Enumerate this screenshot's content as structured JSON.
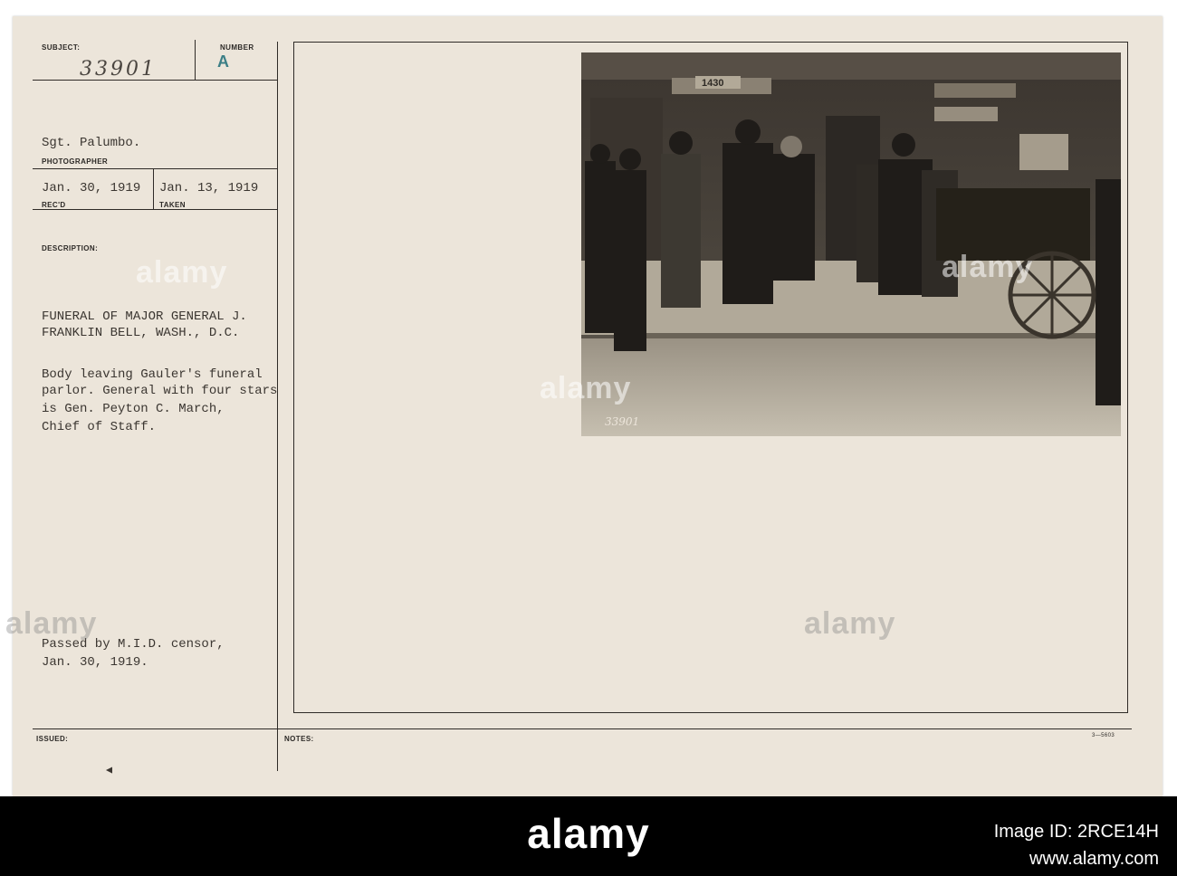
{
  "card": {
    "subject_label": "SUBJECT:",
    "number_label": "NUMBER",
    "subject_value": "33901",
    "number_value": "A",
    "photographer_name": "Sgt. Palumbo.",
    "photographer_label": "PHOTOGRAPHER",
    "recd_date": "Jan. 30, 1919",
    "recd_label": "REC'D",
    "taken_date": "Jan. 13, 1919",
    "taken_label": "TAKEN",
    "description_label": "DESCRIPTION:",
    "description_title_line1": "FUNERAL OF MAJOR GENERAL J.",
    "description_title_line2": "FRANKLIN BELL, WASH., D.C.",
    "description_body_line1": "Body leaving Gauler's funeral",
    "description_body_line2": "parlor. General with four stars",
    "description_body_line3": "is Gen. Peyton C. March,",
    "description_body_line4": "Chief of Staff.",
    "censor_line1": "Passed by M.I.D. censor,",
    "censor_line2": "Jan. 30, 1919.",
    "issued_label": "ISSUED:",
    "notes_label": "NOTES:",
    "form_number": "3—5603",
    "photo_caption_number": "33901"
  },
  "photo_scene": {
    "sign_text": "1430"
  },
  "watermark": {
    "word": "alamy"
  },
  "footer": {
    "logo": "alamy",
    "image_id_line": "Image ID: 2RCE14H",
    "url": "www.alamy.com"
  },
  "colors": {
    "card": "#ece5da",
    "stamp_teal": "#3c7f86",
    "bar": "#000000"
  }
}
